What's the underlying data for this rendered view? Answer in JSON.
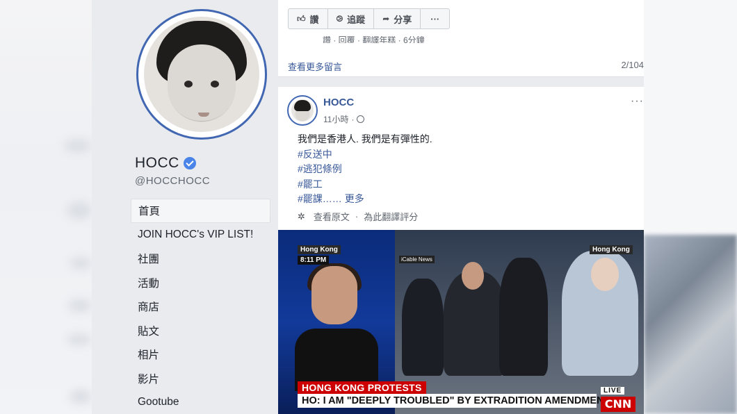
{
  "profile": {
    "name": "HOCC",
    "handle": "@HOCCHOCC"
  },
  "nav": {
    "items": [
      "首頁",
      "JOIN HOCC's VIP LIST!",
      "社團",
      "活動",
      "商店",
      "貼文",
      "相片",
      "影片",
      "Gootube"
    ]
  },
  "top_post": {
    "actions": [
      {
        "icon": "thumbs-up-icon",
        "label": "讚"
      },
      {
        "icon": "follow-icon",
        "label": "追蹤"
      },
      {
        "icon": "share-icon",
        "label": "分享"
      },
      {
        "icon": "more-icon",
        "label": "···"
      }
    ],
    "comment_meta": "讚 · 回覆 · 翻譯年糕 · 6分鐘",
    "more_comments": "查看更多留言",
    "comment_count": "2/104"
  },
  "post": {
    "author": "HOCC",
    "time": "11小時",
    "line1": "我們是香港人. 我們是有彈性的.",
    "tags": [
      "#反送中",
      "#逃犯條例",
      "#罷工"
    ],
    "last_tag": "#罷課……",
    "more": "更多",
    "see_original": "查看原文",
    "rate_translation": "為此翻譯評分",
    "more_icon": "···"
  },
  "video": {
    "left_location": "Hong Kong",
    "time": "8:11 PM",
    "source": "iCable News",
    "right_location": "Hong Kong",
    "headline": "HONG KONG PROTESTS",
    "subhead": "HO: I AM \"DEEPLY TROUBLED\" BY EXTRADITION AMENDMENT",
    "live": "LIVE",
    "logo": "CNN"
  },
  "colors": {
    "accent": "#4267b2",
    "link": "#385898",
    "cnn_red": "#cc0000",
    "verified": "#4a84e8"
  }
}
